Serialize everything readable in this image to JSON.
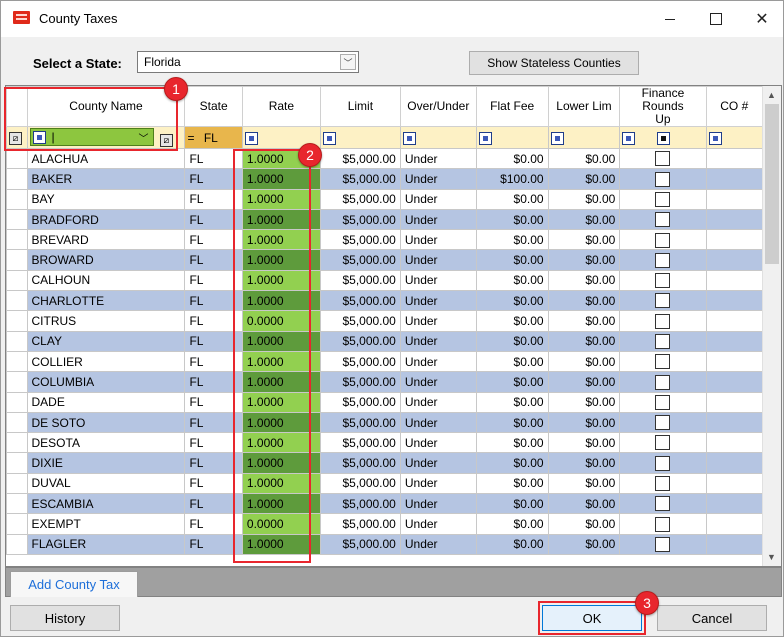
{
  "window": {
    "title": "County Taxes",
    "min_icon": "minimize-icon",
    "max_icon": "maximize-icon",
    "close_glyph": "✕"
  },
  "state_select": {
    "label": "Select a State:",
    "value": "Florida",
    "arrow": "﹀"
  },
  "stateless_button": "Show Stateless Counties",
  "grid": {
    "columns": [
      "County Name",
      "State",
      "Rate",
      "Limit",
      "Over/Under",
      "Flat Fee",
      "Lower Lim",
      "Finance Rounds Up",
      "CO #"
    ],
    "filter": {
      "county_value": "|",
      "state_operator": "=",
      "state_value": "FL"
    },
    "rows": [
      {
        "county": "ALACHUA",
        "state": "FL",
        "rate": "1.0000",
        "limit": "$5,000.00",
        "over_under": "Under",
        "flat_fee": "$0.00",
        "lower_lim": "$0.00",
        "co": ""
      },
      {
        "county": "BAKER",
        "state": "FL",
        "rate": "1.0000",
        "limit": "$5,000.00",
        "over_under": "Under",
        "flat_fee": "$100.00",
        "lower_lim": "$0.00",
        "co": ""
      },
      {
        "county": "BAY",
        "state": "FL",
        "rate": "1.0000",
        "limit": "$5,000.00",
        "over_under": "Under",
        "flat_fee": "$0.00",
        "lower_lim": "$0.00",
        "co": ""
      },
      {
        "county": "BRADFORD",
        "state": "FL",
        "rate": "1.0000",
        "limit": "$5,000.00",
        "over_under": "Under",
        "flat_fee": "$0.00",
        "lower_lim": "$0.00",
        "co": ""
      },
      {
        "county": "BREVARD",
        "state": "FL",
        "rate": "1.0000",
        "limit": "$5,000.00",
        "over_under": "Under",
        "flat_fee": "$0.00",
        "lower_lim": "$0.00",
        "co": ""
      },
      {
        "county": "BROWARD",
        "state": "FL",
        "rate": "1.0000",
        "limit": "$5,000.00",
        "over_under": "Under",
        "flat_fee": "$0.00",
        "lower_lim": "$0.00",
        "co": ""
      },
      {
        "county": "CALHOUN",
        "state": "FL",
        "rate": "1.0000",
        "limit": "$5,000.00",
        "over_under": "Under",
        "flat_fee": "$0.00",
        "lower_lim": "$0.00",
        "co": ""
      },
      {
        "county": "CHARLOTTE",
        "state": "FL",
        "rate": "1.0000",
        "limit": "$5,000.00",
        "over_under": "Under",
        "flat_fee": "$0.00",
        "lower_lim": "$0.00",
        "co": ""
      },
      {
        "county": "CITRUS",
        "state": "FL",
        "rate": "0.0000",
        "limit": "$5,000.00",
        "over_under": "Under",
        "flat_fee": "$0.00",
        "lower_lim": "$0.00",
        "co": ""
      },
      {
        "county": "CLAY",
        "state": "FL",
        "rate": "1.0000",
        "limit": "$5,000.00",
        "over_under": "Under",
        "flat_fee": "$0.00",
        "lower_lim": "$0.00",
        "co": ""
      },
      {
        "county": "COLLIER",
        "state": "FL",
        "rate": "1.0000",
        "limit": "$5,000.00",
        "over_under": "Under",
        "flat_fee": "$0.00",
        "lower_lim": "$0.00",
        "co": ""
      },
      {
        "county": "COLUMBIA",
        "state": "FL",
        "rate": "1.0000",
        "limit": "$5,000.00",
        "over_under": "Under",
        "flat_fee": "$0.00",
        "lower_lim": "$0.00",
        "co": ""
      },
      {
        "county": "DADE",
        "state": "FL",
        "rate": "1.0000",
        "limit": "$5,000.00",
        "over_under": "Under",
        "flat_fee": "$0.00",
        "lower_lim": "$0.00",
        "co": ""
      },
      {
        "county": "DE SOTO",
        "state": "FL",
        "rate": "1.0000",
        "limit": "$5,000.00",
        "over_under": "Under",
        "flat_fee": "$0.00",
        "lower_lim": "$0.00",
        "co": ""
      },
      {
        "county": "DESOTA",
        "state": "FL",
        "rate": "1.0000",
        "limit": "$5,000.00",
        "over_under": "Under",
        "flat_fee": "$0.00",
        "lower_lim": "$0.00",
        "co": ""
      },
      {
        "county": "DIXIE",
        "state": "FL",
        "rate": "1.0000",
        "limit": "$5,000.00",
        "over_under": "Under",
        "flat_fee": "$0.00",
        "lower_lim": "$0.00",
        "co": ""
      },
      {
        "county": "DUVAL",
        "state": "FL",
        "rate": "1.0000",
        "limit": "$5,000.00",
        "over_under": "Under",
        "flat_fee": "$0.00",
        "lower_lim": "$0.00",
        "co": ""
      },
      {
        "county": "ESCAMBIA",
        "state": "FL",
        "rate": "1.0000",
        "limit": "$5,000.00",
        "over_under": "Under",
        "flat_fee": "$0.00",
        "lower_lim": "$0.00",
        "co": ""
      },
      {
        "county": "EXEMPT",
        "state": "FL",
        "rate": "0.0000",
        "limit": "$5,000.00",
        "over_under": "Under",
        "flat_fee": "$0.00",
        "lower_lim": "$0.00",
        "co": ""
      },
      {
        "county": "FLAGLER",
        "state": "FL",
        "rate": "1.0000",
        "limit": "$5,000.00",
        "over_under": "Under",
        "flat_fee": "$0.00",
        "lower_lim": "$0.00",
        "co": ""
      }
    ]
  },
  "tabs": {
    "add_county_tax": "Add County Tax"
  },
  "buttons": {
    "history": "History",
    "ok": "OK",
    "cancel": "Cancel"
  },
  "callouts": [
    "1",
    "2",
    "3"
  ],
  "colors": {
    "callout_red": "#e8262d",
    "rate_light_green": "#92d050",
    "rate_dark_green": "#5e9b3c",
    "row_alt_blue": "#b5c5e2",
    "filter_row_bg": "#fdf1c5",
    "link_blue": "#1e6fd9"
  }
}
